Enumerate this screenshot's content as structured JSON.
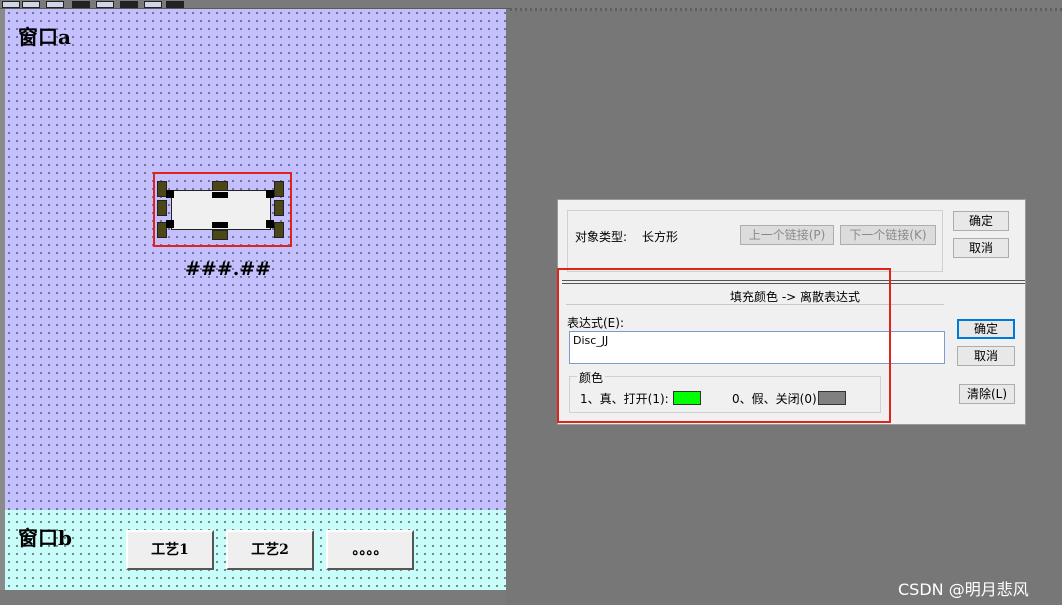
{
  "window_a": {
    "title": "窗口a"
  },
  "window_b": {
    "title": "窗口b",
    "buttons": [
      "工艺1",
      "工艺2",
      "。。。。"
    ]
  },
  "canvas": {
    "number_format": "###.##"
  },
  "dialog": {
    "object_type_label": "对象类型:",
    "object_type_value": "长方形",
    "prev_link": "上一个链接(P)",
    "next_link": "下一个链接(K)",
    "ok_top": "确定",
    "cancel_top": "取消",
    "section_title": "填充颜色 -> 离散表达式",
    "expression_label": "表达式(E):",
    "expression_value": "Disc_JJ",
    "ok": "确定",
    "cancel": "取消",
    "color_group": "颜色",
    "true_label": "1、真、打开(1):",
    "false_label": "0、假、关闭(0):",
    "clear": "清除(L)",
    "colors": {
      "true": "#00ff00",
      "false": "#808080"
    }
  },
  "watermark": "CSDN @明月悲风"
}
